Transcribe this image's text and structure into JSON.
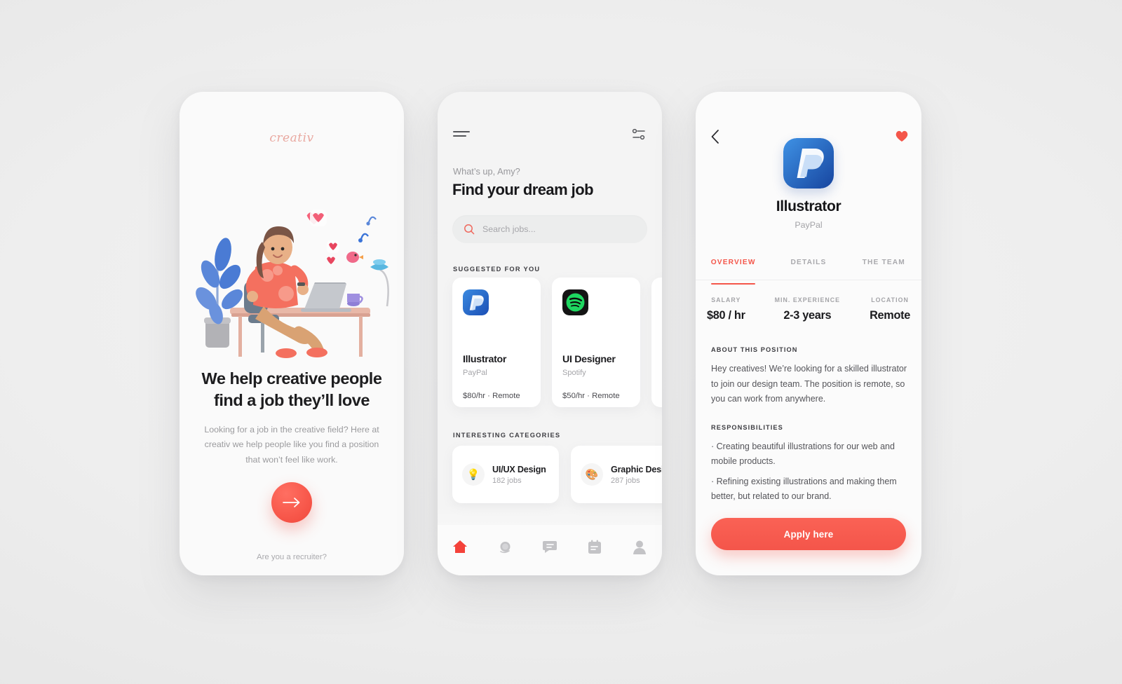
{
  "theme": {
    "accent": "#f4564a",
    "bg": "#ececec",
    "text_dark": "#1b1b1e",
    "text_muted": "#a5a5a9"
  },
  "onboarding": {
    "logo": "creativ",
    "illustration": "woman-at-desk-illustration",
    "headline": "We help creative people find a job they’ll love",
    "subtext": "Looking for a job in the creative field? Here at creativ we help people like you find a position that won’t feel like work.",
    "cta_icon": "arrow-right-icon",
    "footer_link": "Are you a recruiter?"
  },
  "home": {
    "menu_icon": "hamburger-menu-icon",
    "filter_icon": "filter-sliders-icon",
    "greeting": "What’s up, Amy?",
    "title": "Find your dream job",
    "search": {
      "value": "",
      "placeholder": "Search jobs...",
      "icon": "search-icon"
    },
    "suggested_label": "SUGGESTED FOR YOU",
    "jobs": [
      {
        "title": "Illustrator",
        "company": "PayPal",
        "meta": "$80/hr · Remote",
        "logo": "paypal-logo"
      },
      {
        "title": "UI Designer",
        "company": "Spotify",
        "meta": "$50/hr · Remote",
        "logo": "spotify-logo"
      },
      {
        "title": "",
        "company": "",
        "meta": "",
        "logo": "partial-card-logo"
      }
    ],
    "categories_label": "INTERESTING CATEGORIES",
    "categories": [
      {
        "name": "UI/UX Design",
        "jobs": "182 jobs",
        "icon": "💡"
      },
      {
        "name": "Graphic Design",
        "jobs": "287 jobs",
        "icon": "🎨"
      }
    ],
    "nav": [
      {
        "name": "home",
        "icon": "home-icon",
        "active": true
      },
      {
        "name": "explore",
        "icon": "globe-icon",
        "active": false
      },
      {
        "name": "messages",
        "icon": "chat-bubble-icon",
        "active": false
      },
      {
        "name": "applications",
        "icon": "calendar-icon",
        "active": false
      },
      {
        "name": "profile",
        "icon": "person-icon",
        "active": false
      }
    ]
  },
  "detail": {
    "back_icon": "chevron-left-icon",
    "favorite_icon": "heart-icon",
    "logo": "paypal-logo",
    "job_title": "Illustrator",
    "company": "PayPal",
    "tabs": [
      {
        "label": "OVERVIEW",
        "active": true
      },
      {
        "label": "DETAILS",
        "active": false
      },
      {
        "label": "THE TEAM",
        "active": false
      }
    ],
    "stats": [
      {
        "key": "SALARY",
        "value": "$80 / hr"
      },
      {
        "key": "MIN. EXPERIENCE",
        "value": "2-3 years"
      },
      {
        "key": "LOCATION",
        "value": "Remote"
      }
    ],
    "about_heading": "ABOUT THIS POSITION",
    "about_body": "Hey creatives! We’re looking for a skilled illustrator to join our design team. The position is remote, so you can work from anywhere.",
    "responsibilities_heading": "RESPONSIBILITIES",
    "responsibilities": [
      "· Creating beautiful illustrations for our web and mobile products.",
      "· Refining existing illustrations and making them better, but related to our brand."
    ],
    "apply_label": "Apply here"
  }
}
